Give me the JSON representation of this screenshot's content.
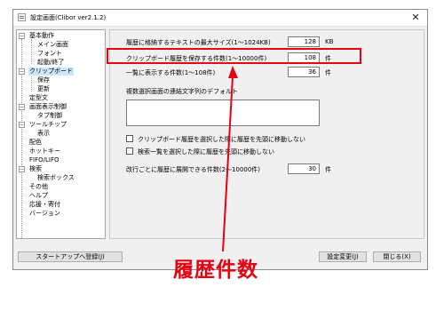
{
  "window": {
    "title": "設定画面(Clibor ver2.1.2)",
    "close_glyph": "✕"
  },
  "tree": {
    "items": [
      {
        "label": "基本動作",
        "expander": "−"
      },
      {
        "label": "メイン画面"
      },
      {
        "label": "フォント"
      },
      {
        "label": "起動/終了"
      },
      {
        "label": "クリップボード",
        "expander": "−"
      },
      {
        "label": "保存"
      },
      {
        "label": "更新"
      },
      {
        "label": "定型文"
      },
      {
        "label": "画面表示制御",
        "expander": "−"
      },
      {
        "label": "タブ制御"
      },
      {
        "label": "ツールチップ",
        "expander": "−"
      },
      {
        "label": "表示"
      },
      {
        "label": "配色"
      },
      {
        "label": "ホットキー"
      },
      {
        "label": "FIFO/LIFO"
      },
      {
        "label": "検索",
        "expander": "−"
      },
      {
        "label": "検索ボックス"
      },
      {
        "label": "その他"
      },
      {
        "label": "ヘルプ"
      },
      {
        "label": "応援・寄付"
      },
      {
        "label": "バージョン"
      }
    ]
  },
  "settings": {
    "max_text_size": {
      "label": "履歴に格納するテキストの最大サイズ(1〜1024KB)",
      "value": "128",
      "unit": "KB"
    },
    "history_count": {
      "label": "クリップボード履歴を保存する件数(1〜10000件)",
      "value": "108",
      "unit": "件"
    },
    "list_count": {
      "label": "一覧に表示する件数(1〜108件)",
      "value": "36",
      "unit": "件"
    },
    "multi_select": {
      "label": "複数選択画面の連結文字列のデフォルト",
      "value": ""
    },
    "check_no_move_clip": {
      "label": "クリップボード履歴を選択した際に履歴を先頭に移動しない",
      "checked": false
    },
    "check_no_move_search": {
      "label": "検索一覧を選択した際に履歴を先頭に移動しない",
      "checked": false
    },
    "line_expand": {
      "label": "改行ごとに履歴に展開できる件数(2〜10000件)",
      "value": "30",
      "unit": "件"
    }
  },
  "buttons": {
    "startup": "スタートアップへ登録(J)",
    "apply": "設定変更(J)",
    "close": "閉じる(X)"
  },
  "caption": "履歴件数",
  "colors": {
    "highlight": "#e60012",
    "selection": "#cce8ff"
  }
}
